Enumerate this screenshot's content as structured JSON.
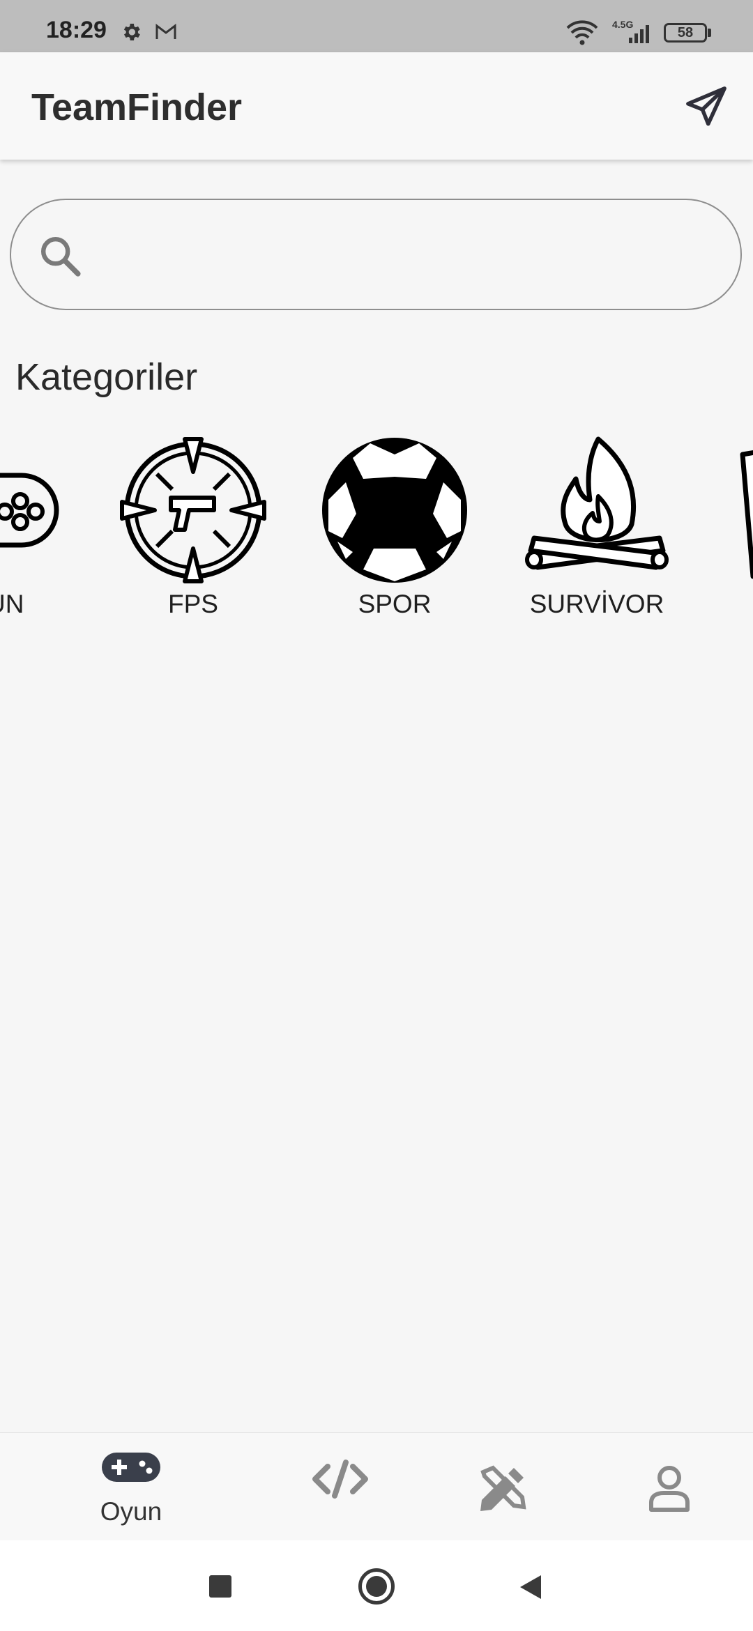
{
  "status_bar": {
    "time": "18:29",
    "network": "4.5G",
    "battery": "58",
    "icons": [
      "gear-icon",
      "gmail-icon",
      "wifi-icon",
      "signal-icon",
      "battery-icon"
    ]
  },
  "app_bar": {
    "title": "TeamFinder",
    "action_icon": "send-icon"
  },
  "search": {
    "value": "",
    "placeholder": "",
    "icon": "search-icon"
  },
  "categories": {
    "title": "Kategoriler",
    "items": [
      {
        "label": "OYUN",
        "icon": "gamepad-icon"
      },
      {
        "label": "FPS",
        "icon": "crosshair-gun-icon"
      },
      {
        "label": "SPOR",
        "icon": "soccer-ball-icon"
      },
      {
        "label": "SURVİVOR",
        "icon": "campfire-icon"
      },
      {
        "label": "",
        "icon": "card-icon"
      }
    ]
  },
  "bottom_nav": {
    "items": [
      {
        "label": "Oyun",
        "icon": "gamepad-icon",
        "active": true
      },
      {
        "label": "",
        "icon": "code-icon",
        "active": false
      },
      {
        "label": "",
        "icon": "design-tools-icon",
        "active": false
      },
      {
        "label": "",
        "icon": "profile-icon",
        "active": false
      }
    ]
  },
  "colors": {
    "status_bar_bg": "#bdbdbd",
    "background": "#f6f6f6",
    "active_icon": "#3a3f4b",
    "inactive_icon": "#8a8a8a"
  }
}
